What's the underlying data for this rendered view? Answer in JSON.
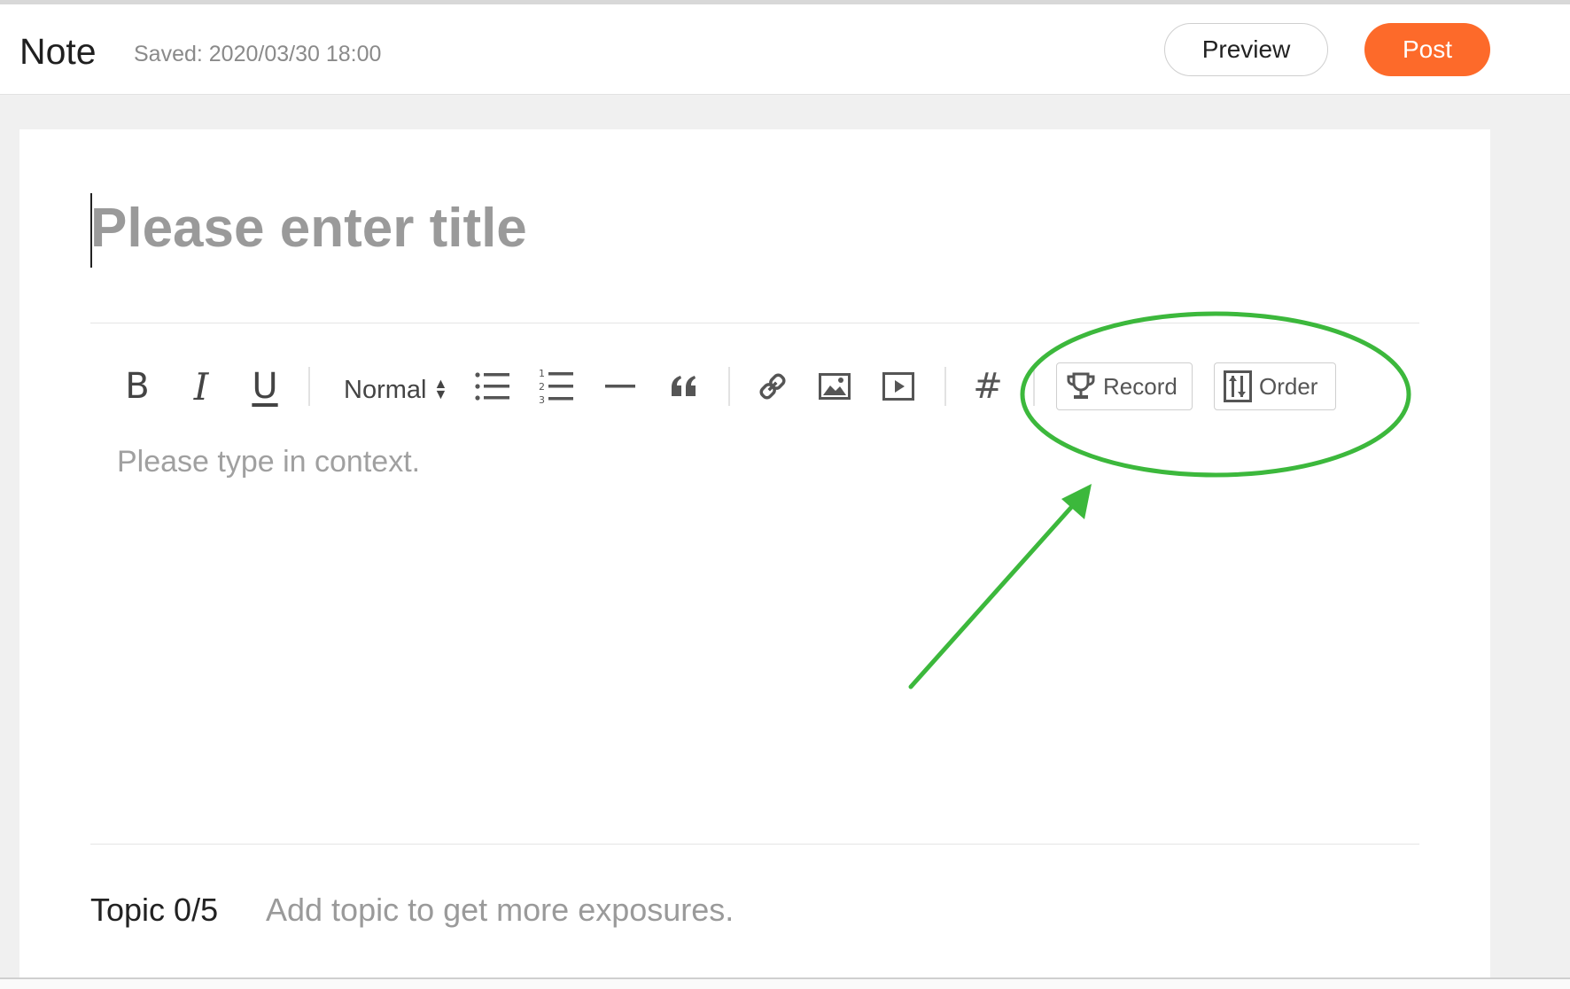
{
  "header": {
    "title": "Note",
    "saved": "Saved: 2020/03/30 18:00",
    "preview_label": "Preview",
    "post_label": "Post"
  },
  "editor": {
    "title_placeholder": "Please enter title",
    "body_placeholder": "Please type in context.",
    "toolbar": {
      "bold": "B",
      "italic": "I",
      "underline": "U",
      "format_value": "Normal",
      "hashtag": "#",
      "record_label": "Record",
      "order_label": "Order"
    },
    "topic_label": "Topic 0/5",
    "topic_placeholder": "Add topic to get more exposures."
  },
  "colors": {
    "accent": "#fd6a2a",
    "annotation": "#3cb83c"
  },
  "icons": [
    "bullet-list-icon",
    "numbered-list-icon",
    "horizontal-rule-icon",
    "quote-icon",
    "link-icon",
    "image-icon",
    "video-icon",
    "trophy-icon",
    "order-icon"
  ]
}
